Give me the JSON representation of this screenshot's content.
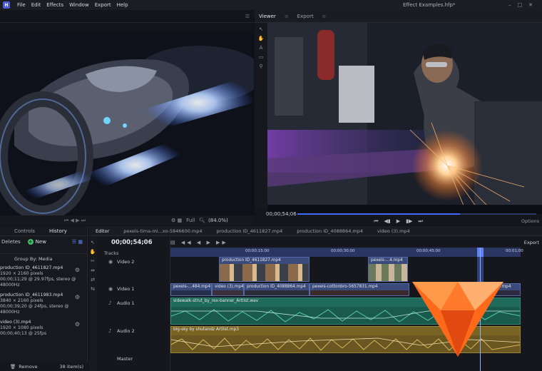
{
  "menubar": {
    "items": [
      "File",
      "Edit",
      "Effects",
      "Window",
      "Export",
      "Help"
    ],
    "title": "Effect Examples.hfp*"
  },
  "left_preview": {
    "image": "motorcycle-neon-render",
    "zoom_hint": "Full"
  },
  "viewer": {
    "tabs": [
      "Viewer",
      "Export"
    ],
    "image": "welder-sparks",
    "fit": "Full",
    "zoom": "(84.0%)",
    "timecode": "00;00;54;06",
    "options_label": "Options",
    "progress": 0.68
  },
  "media_panel": {
    "tabs": [
      "Controls",
      "History"
    ],
    "deletes_label": "Deletes",
    "new_label": "New",
    "group_by": "Group By: Media",
    "items": [
      {
        "name": "production ID_4611827.mp4",
        "line1": "1920 × 2160 pixels",
        "line2": "00;00;11;29 @ 29.97fps, stereo @ 48000Hz"
      },
      {
        "name": "production ID_4611983.mp4",
        "line1": "3840 × 2160 pixels",
        "line2": "00;00;39;20 @ 24fps, stereo @ 48000Hz"
      },
      {
        "name": "video (3).mp4",
        "line1": "1920 × 1080 pixels",
        "line2": "00;00;40;13 @ 25fps"
      }
    ],
    "remove_label": "Remove",
    "count_label": "38 item(s)"
  },
  "timeline": {
    "tabs": [
      "Editor",
      "pexels-tima-mi...xo-5846600.mp4",
      "production ID_4611827.mp4",
      "production ID_4088864.mp4",
      "video (3).mp4"
    ],
    "timecode": "00;00;54;06",
    "export_label": "Export",
    "tracks_label": "Tracks",
    "tracks": [
      "Video 2",
      "Video 1",
      "Audio 1",
      "Audio 2",
      "Master"
    ],
    "ruler": [
      "00;00;15;00",
      "00;00;30;00",
      "00;00;45;00",
      "00;01;00"
    ],
    "clips": {
      "v2a": "production ID_4611827.mp4",
      "v2b": "pexels-...4.mp4",
      "v1a": "pexels-...484.mp4",
      "v1b": "video (3).mp4",
      "v1c": "production ID_4088864.mp4",
      "v1d": "pexels-cottonbro-5657831.mp4",
      "v1e": "...mp4",
      "a1": "sidewalk-strut_by_rex-banner_Artlist.wav",
      "a2": "big-sky by shutandz Artlist.mp3"
    }
  },
  "colors": {
    "accent": "#3f6bff",
    "audio1": "#1f6a5a",
    "audio2": "#7a6424",
    "video": "#3a4a7a",
    "logo_orange": "#ff6a1a"
  }
}
